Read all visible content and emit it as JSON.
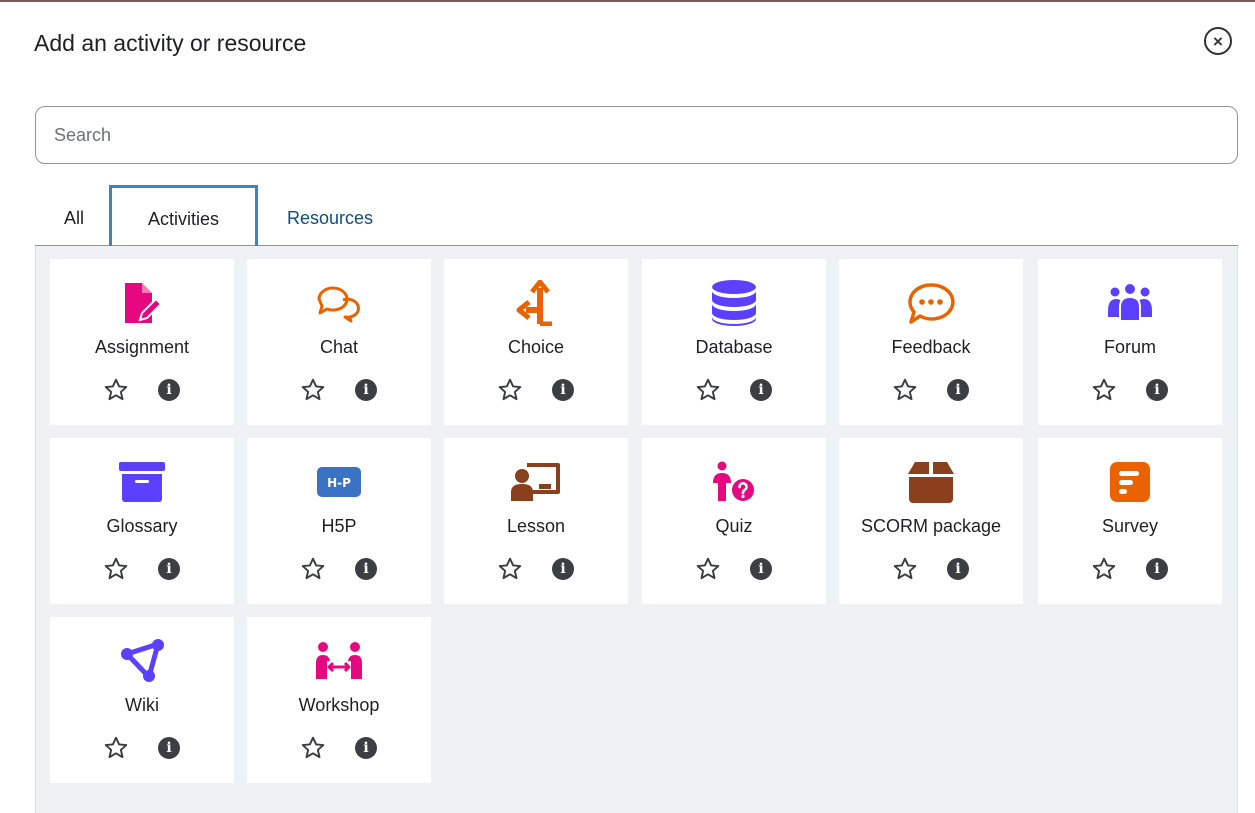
{
  "modal": {
    "title": "Add an activity or resource",
    "close_symbol": "×"
  },
  "search": {
    "placeholder": "Search",
    "value": ""
  },
  "tabs": [
    {
      "label": "All"
    },
    {
      "label": "Activities",
      "active": true
    },
    {
      "label": "Resources"
    }
  ],
  "info_symbol": "i",
  "items": [
    {
      "label": "Assignment",
      "icon": "assignment-icon",
      "color": "#e5087f"
    },
    {
      "label": "Chat",
      "icon": "chat-icon",
      "color": "#eb6200"
    },
    {
      "label": "Choice",
      "icon": "choice-icon",
      "color": "#eb6200"
    },
    {
      "label": "Database",
      "icon": "database-icon",
      "color": "#5b40ff"
    },
    {
      "label": "Feedback",
      "icon": "feedback-icon",
      "color": "#eb6200"
    },
    {
      "label": "Forum",
      "icon": "forum-icon",
      "color": "#5b40ff"
    },
    {
      "label": "Glossary",
      "icon": "glossary-icon",
      "color": "#5b40ff"
    },
    {
      "label": "H5P",
      "icon": "h5p-icon",
      "color": "#3a72c4",
      "icon_text": "H-P"
    },
    {
      "label": "Lesson",
      "icon": "lesson-icon",
      "color": "#8a3f1d"
    },
    {
      "label": "Quiz",
      "icon": "quiz-icon",
      "color": "#e5087f"
    },
    {
      "label": "SCORM package",
      "icon": "scorm-package-icon",
      "color": "#8a3f1d"
    },
    {
      "label": "Survey",
      "icon": "survey-icon",
      "color": "#eb6200"
    },
    {
      "label": "Wiki",
      "icon": "wiki-icon",
      "color": "#5b40ff"
    },
    {
      "label": "Workshop",
      "icon": "workshop-icon",
      "color": "#e5087f"
    }
  ]
}
